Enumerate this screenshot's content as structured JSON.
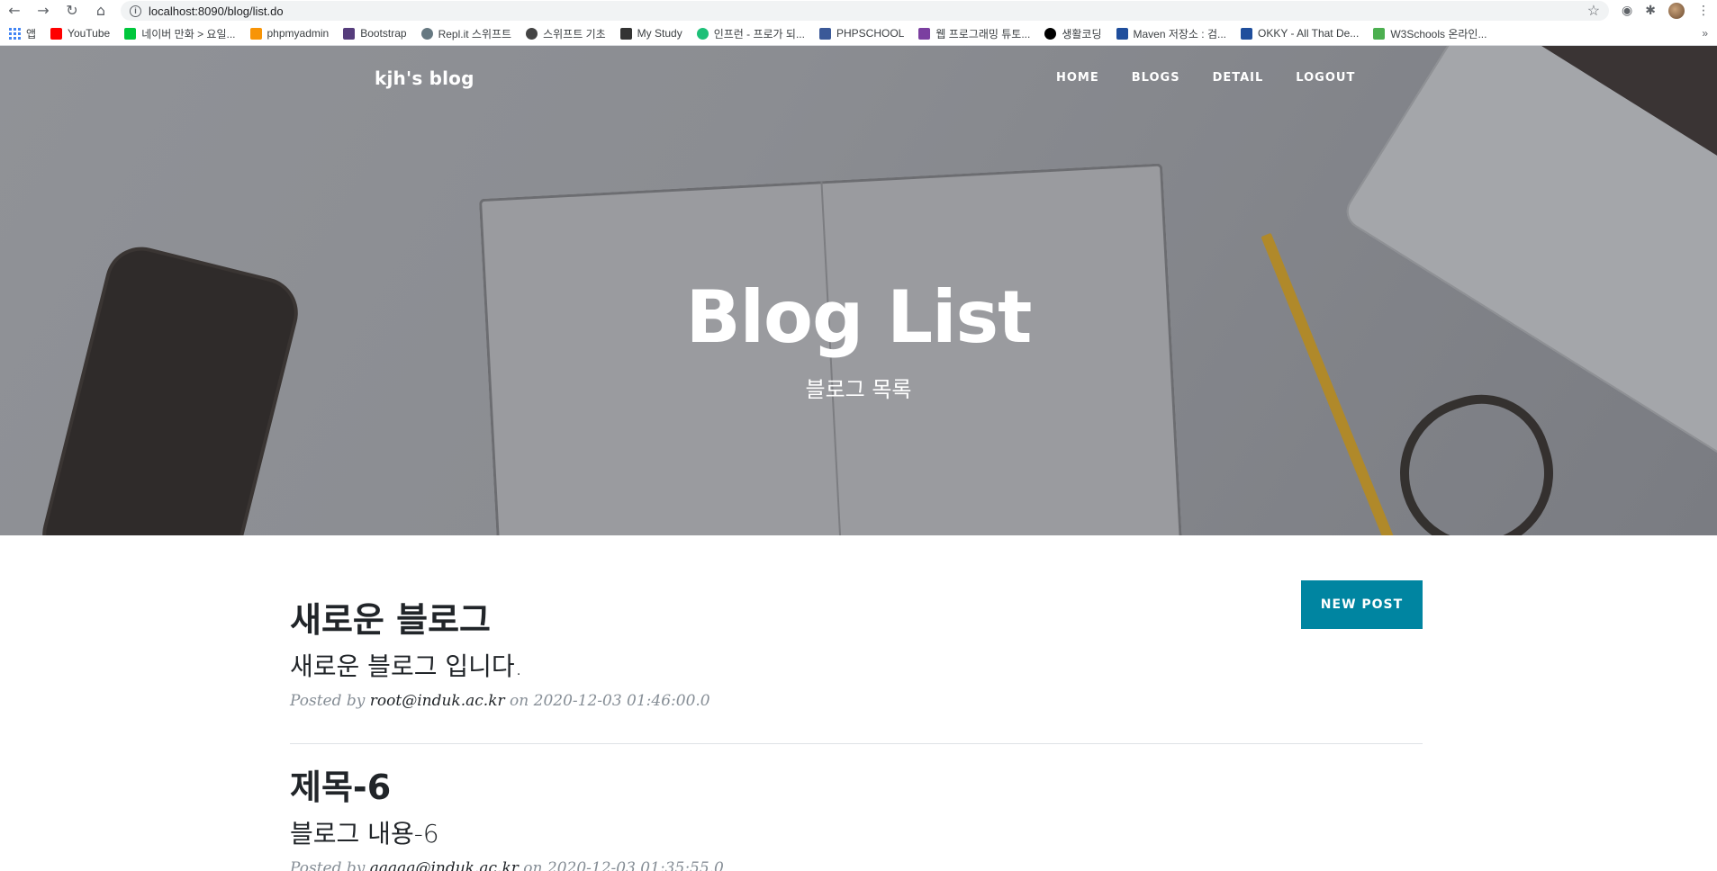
{
  "browser": {
    "url": "localhost:8090/blog/list.do",
    "bookmarks": [
      {
        "label": "앱",
        "color": "#4285f4"
      },
      {
        "label": "YouTube",
        "color": "#ff0000"
      },
      {
        "label": "네이버 만화 > 요일...",
        "color": "#00c73c"
      },
      {
        "label": "phpmyadmin",
        "color": "#f89406"
      },
      {
        "label": "Bootstrap",
        "color": "#563d7c"
      },
      {
        "label": "Repl.it 스위프트",
        "color": "#667881"
      },
      {
        "label": "스위프트 기초",
        "color": "#444444"
      },
      {
        "label": "My Study",
        "color": "#333333"
      },
      {
        "label": "인프런 - 프로가 되...",
        "color": "#1dc078"
      },
      {
        "label": "PHPSCHOOL",
        "color": "#3b5998"
      },
      {
        "label": "웹 프로그래밍 튜토...",
        "color": "#7b3fa0"
      },
      {
        "label": "생활코딩",
        "color": "#000000"
      },
      {
        "label": "Maven 저장소 : 검...",
        "color": "#1f4e9c"
      },
      {
        "label": "OKKY - All That De...",
        "color": "#1f4e9c"
      },
      {
        "label": "W3Schools 온라인...",
        "color": "#4caf50"
      }
    ],
    "more": "»"
  },
  "nav": {
    "brand": "kjh's blog",
    "items": [
      "HOME",
      "BLOGS",
      "DETAIL",
      "LOGOUT"
    ]
  },
  "hero": {
    "title": "Blog List",
    "subtitle": "블로그 목록"
  },
  "actions": {
    "new_post": "NEW POST"
  },
  "posts": [
    {
      "title": "새로운 블로그",
      "subtitle": "새로운 블로그 입니다.",
      "posted_by_prefix": "Posted by",
      "author": "root@induk.ac.kr",
      "on_text": "on",
      "date": "2020-12-03 01:46:00.0"
    },
    {
      "title": "제목-6",
      "subtitle": "블로그 내용-6",
      "posted_by_prefix": "Posted by",
      "author": "aaaaa@induk.ac.kr",
      "on_text": "on",
      "date": "2020-12-03 01:35:55.0"
    }
  ]
}
